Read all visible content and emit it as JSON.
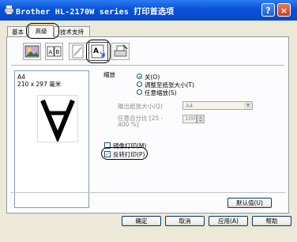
{
  "window": {
    "title": "Brother HL-2170W series 打印首选项"
  },
  "titlebar_buttons": {
    "help": "?",
    "close": "×"
  },
  "tabs": [
    {
      "label": "基本"
    },
    {
      "label": "高级"
    },
    {
      "label": "技术支持"
    }
  ],
  "toolbar": {
    "icons": [
      "print-quality-icon",
      "duplex-booklet-icon",
      "watermark-icon",
      "scaling-icon",
      "other-print-options-icon"
    ]
  },
  "preview": {
    "paper_size": "A4",
    "dimensions": "210 x 297 毫米",
    "glyph": "A"
  },
  "scaling": {
    "label": "缩放",
    "options": [
      {
        "label": "关(O)",
        "selected": true
      },
      {
        "label": "调整至纸张大小(T)",
        "selected": false
      },
      {
        "label": "任意缩放(S)",
        "selected": false
      }
    ],
    "output_paper_label": "输出纸张大小(Q)",
    "output_paper_value": "A4",
    "free_percent_label": "任意百分比 [25 - 400 %]",
    "free_percent_value": "100"
  },
  "options": {
    "mirror_print": {
      "label": "镜像打印(M)",
      "checked": false
    },
    "reverse_print": {
      "label": "反转打印(P)",
      "checked": true
    }
  },
  "buttons": {
    "default": "默认值(U)",
    "ok": "确定",
    "cancel": "取消",
    "apply": "应用(A)",
    "help": "帮助"
  },
  "colors": {
    "titlebar": "#0a53d8",
    "panel_bg": "#fcfcfe",
    "window_bg": "#ece9d8",
    "tab_accent": "#e6a23c"
  }
}
